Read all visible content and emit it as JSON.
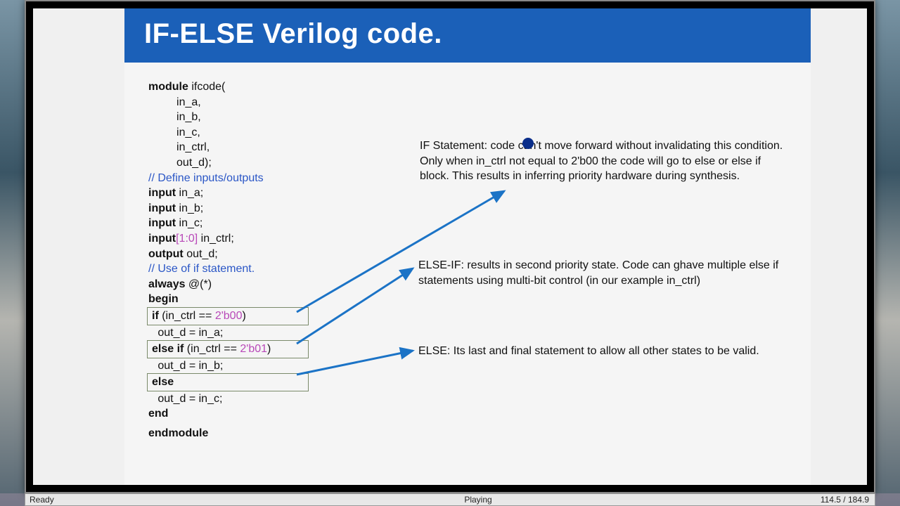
{
  "slide": {
    "title": "IF-ELSE Verilog code.",
    "code": {
      "module_kw": "module",
      "module_name": " ifcode(",
      "ports": [
        "in_a,",
        "in_b,",
        "in_c,",
        "in_ctrl,",
        "out_d);"
      ],
      "comment_define": "// Define inputs/outputs",
      "input_kw": "input",
      "inputs": [
        " in_a;",
        " in_b;",
        " in_c;"
      ],
      "input_range": "[1:0]",
      "input_ctrl": " in_ctrl;",
      "output_kw": "output",
      "output_name": " out_d;",
      "comment_use": "// Use of if statement.",
      "always_kw": "always",
      "always_sens": " @(*)",
      "begin_kw": "begin",
      "if_kw": "if",
      "if_cond_pre": " (in_ctrl == ",
      "if_cond_val": "2'b00",
      "if_cond_post": ")",
      "assign_a": "   out_d = in_a;",
      "elseif_kw": "else if",
      "elseif_cond_pre": " (in_ctrl == ",
      "elseif_cond_val": "2'b01",
      "elseif_cond_post": ")",
      "assign_b": "   out_d = in_b;",
      "else_kw": "else",
      "assign_c": "   out_d = in_c;",
      "end_kw": "end",
      "endmodule_kw": "endmodule"
    },
    "annotations": {
      "if": "IF Statement: code can't move forward without invalidating this condition. Only when in_ctrl not equal to 2'b00 the code will go to else or else if block. This results in inferring priority hardware during synthesis.",
      "elseif": "ELSE-IF: results in second priority state. Code can ghave multiple else if statements using multi-bit control (in our example in_ctrl)",
      "else": "ELSE: Its last and final statement to allow all other states to be valid."
    }
  },
  "status": {
    "left": "Ready",
    "center": "Playing",
    "right": "114.5 / 184.9"
  }
}
